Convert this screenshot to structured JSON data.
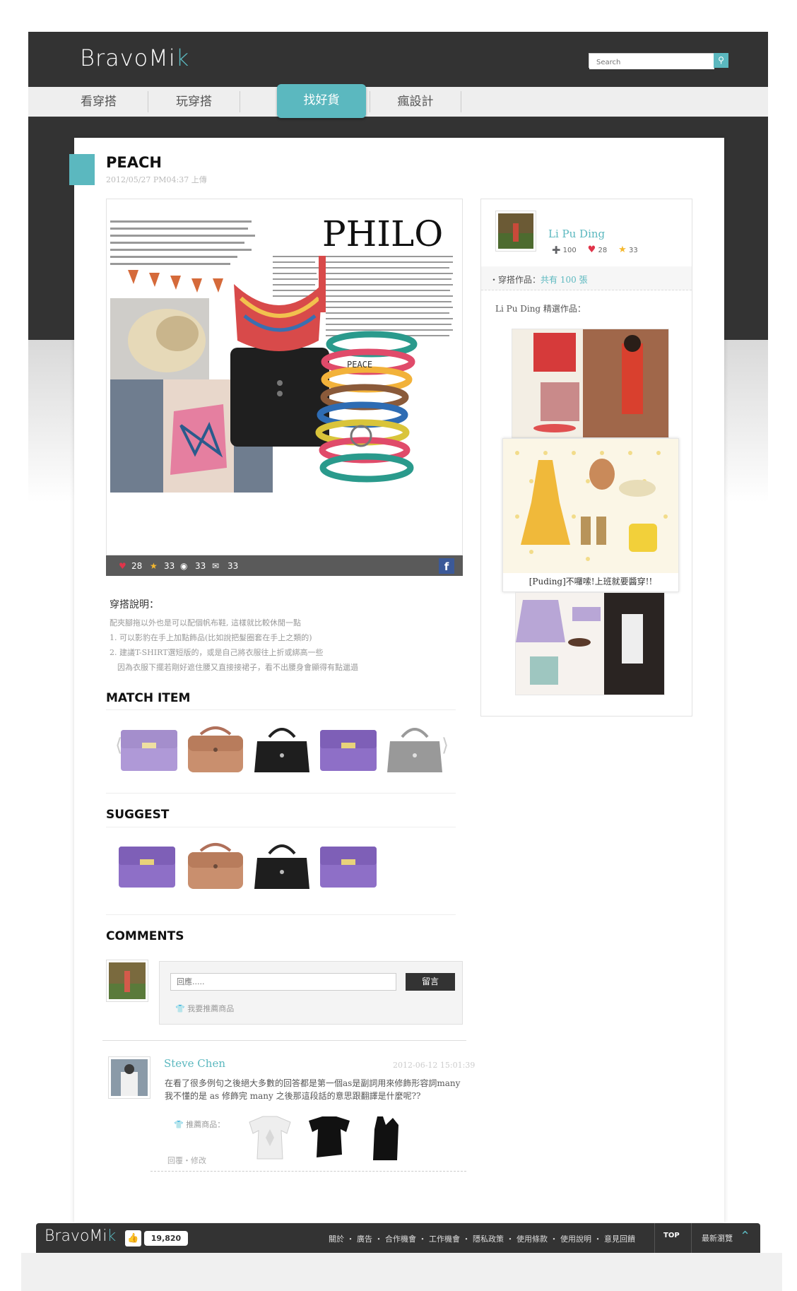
{
  "header": {
    "logo": "BravoMi",
    "logo_mark": "k",
    "search_placeholder": "Search",
    "search_icon": "magnifier-icon"
  },
  "nav": {
    "items": [
      "看穿搭",
      "玩穿搭",
      "找好貨",
      "瘋設計"
    ],
    "active_index": 2
  },
  "post": {
    "title": "PEACH",
    "date": "2012/05/27 PM04:37 上傳",
    "collage_text": "PHILO",
    "collage_word": "PEACE",
    "stats": {
      "likes": "28",
      "stars": "33",
      "views": "33",
      "comments": "33"
    },
    "description": {
      "heading": "穿搭說明：",
      "lines": [
        "配夾腳拖以外也是可以配個帆布鞋, 這樣就比較休閒一點",
        "1. 可以影豹在手上加點飾品(比如說把髮圈套在手上之類的)",
        "2. 建議T-SHIRT選短版的，或是自己將衣服往上折或綁高一些",
        "因為衣服下擺若剛好遮住腰又直接接裙子，看不出腰身會顯得有點邋遢"
      ]
    }
  },
  "sections": {
    "match_item": "MATCH ITEM",
    "suggest": "SUGGEST",
    "comments": "COMMENTS"
  },
  "user": {
    "name": "Li Pu Ding",
    "stats": {
      "followers": "100",
      "hearts": "28",
      "stars": "33"
    },
    "works_label": "穿搭作品：",
    "works_count": "共有 100 張",
    "selected_label": "Li Pu Ding 精選作品：",
    "featured_caption": "[Puding]不囉嗦!上班就要醬穿!!"
  },
  "comment_form": {
    "placeholder": "回應.....",
    "submit_label": "留言",
    "recommend_label": "我要推薦商品"
  },
  "comment": {
    "author": "Steve Chen",
    "date": "2012-06-12 15:01:39",
    "lines": [
      "在看了很多例句之後絕大多數的回答都是第一個as是副詞用來修飾形容詞many",
      "我不懂的是 as 修飾完 many 之後那這段話的意思跟翻譯是什麼呢??"
    ],
    "recommended_label": "推薦商品：",
    "actions": "回覆・修改"
  },
  "footer": {
    "logo": "BravoMi",
    "logo_mark": "k",
    "like_count": "19,820",
    "links": "關於 ・ 廣告 ・ 合作機會 ・ 工作機會 ・ 隱私政策 ・ 使用條款 ・ 使用說明 ・ 意見回饋",
    "top": "TOP",
    "latest": "最新瀏覽"
  },
  "colors": {
    "accent": "#5bb8bf",
    "dark": "#333333",
    "purple": "#8e6fc7",
    "tan": "#c98f6e"
  }
}
